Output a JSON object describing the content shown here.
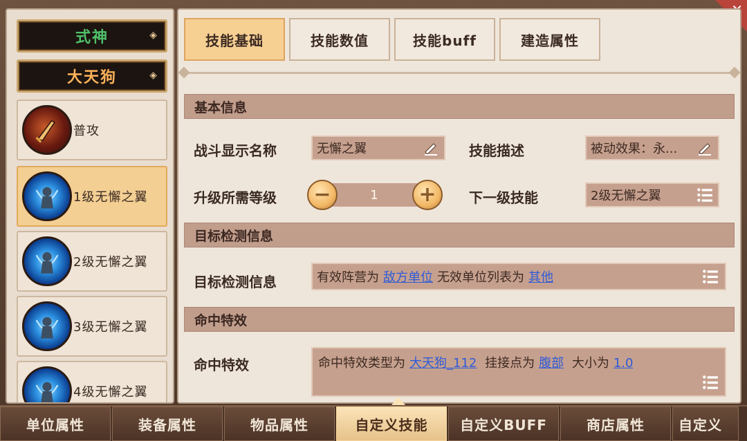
{
  "left_panel": {
    "category_dropdown": "式神",
    "unit_dropdown": "大天狗",
    "skills": [
      {
        "label": "普攻",
        "icon": "sword-icon",
        "active": false
      },
      {
        "label": "1级无懈之翼",
        "icon": "tengu-wing-icon",
        "active": true
      },
      {
        "label": "2级无懈之翼",
        "icon": "tengu-wing-icon",
        "active": false
      },
      {
        "label": "3级无懈之翼",
        "icon": "tengu-wing-icon",
        "active": false
      },
      {
        "label": "4级无懈之翼",
        "icon": "tengu-wing-icon",
        "active": false
      }
    ]
  },
  "top_tabs": [
    "技能基础",
    "技能数值",
    "技能buff",
    "建造属性"
  ],
  "sections": {
    "basic_info": {
      "title": "基本信息",
      "battle_name_label": "战斗显示名称",
      "battle_name_value": "无懈之翼",
      "desc_label": "技能描述",
      "desc_value": "被动效果：永...",
      "level_req_label": "升级所需等级",
      "level_req_value": "1",
      "next_skill_label": "下一级技能",
      "next_skill_value": "2级无懈之翼"
    },
    "target_detect": {
      "title": "目标检测信息",
      "label": "目标检测信息",
      "text1": "有效阵营为",
      "link1": "敌方单位",
      "text2": "无效单位列表为",
      "link2": "其他"
    },
    "hit_effect": {
      "title": "命中特效",
      "label": "命中特效",
      "text1": "命中特效类型为",
      "link1": "大天狗_112",
      "text2": "挂接点为",
      "link2": "腹部",
      "text3": "大小为",
      "link3": "1.0"
    }
  },
  "bottom_tabs": [
    "单位属性",
    "装备属性",
    "物品属性",
    "自定义技能",
    "自定义BUFF",
    "商店属性",
    "自定义"
  ],
  "colors": {
    "active_tab": "#f6cf93",
    "section_header": "#c19d8c",
    "link": "#2f5bd8",
    "category_text": "#4fc06a",
    "unit_text": "#ffb35a"
  }
}
